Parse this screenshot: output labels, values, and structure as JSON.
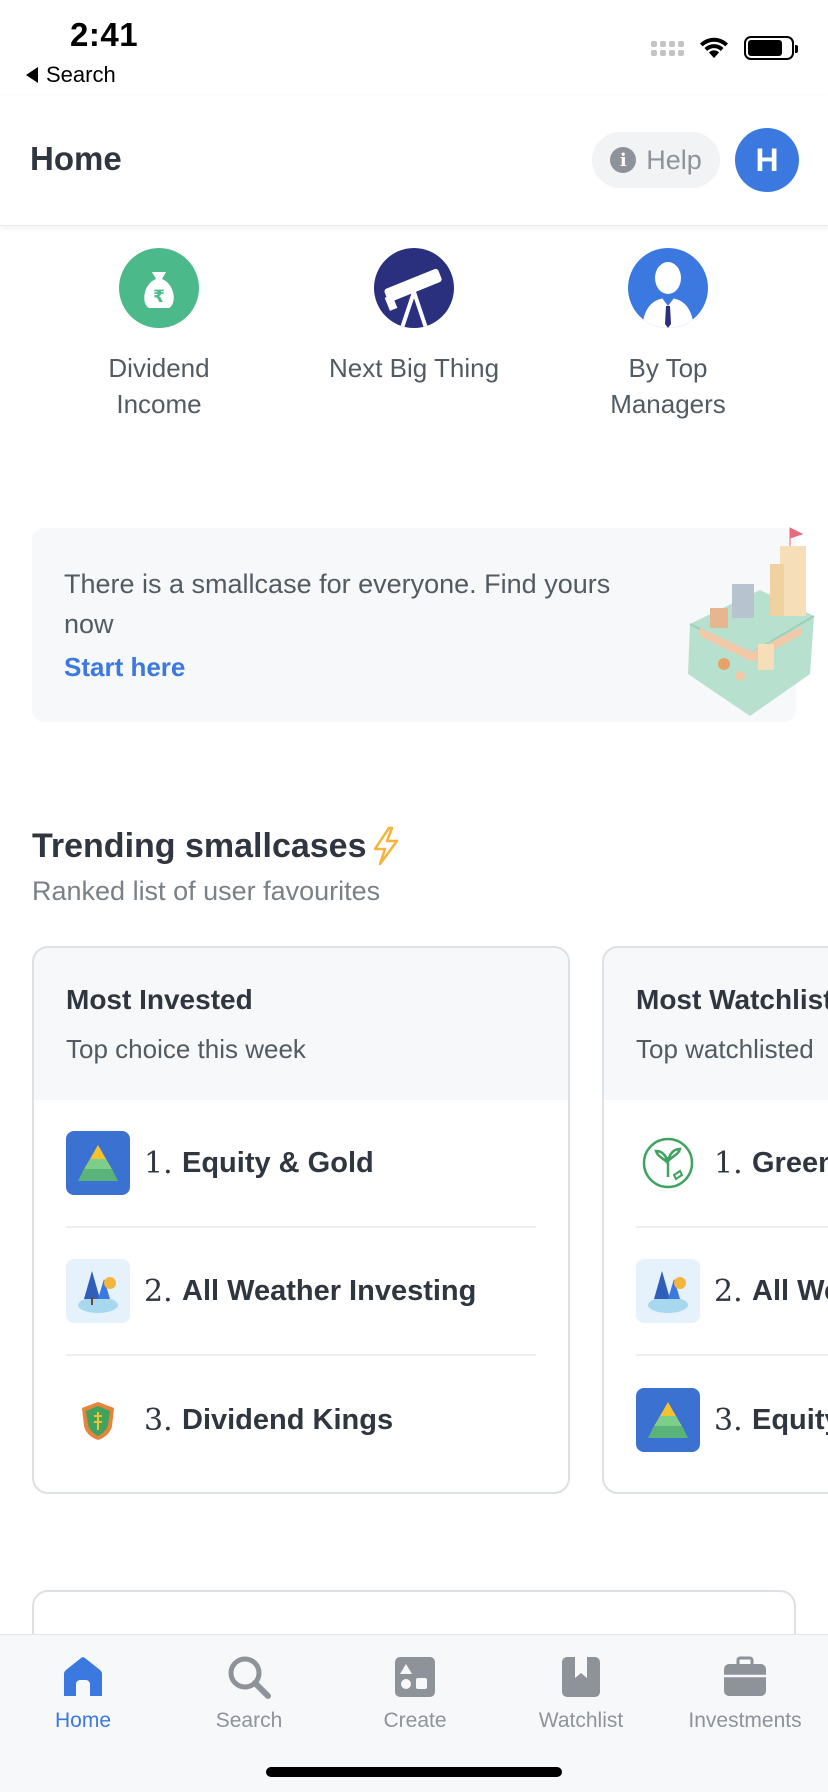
{
  "status_bar": {
    "time": "2:41",
    "back_label": "Search"
  },
  "header": {
    "title": "Home",
    "help_label": "Help",
    "avatar_initial": "H"
  },
  "categories": [
    {
      "label": "Dividend Income",
      "icon": "money-bag-icon",
      "color": "#4cb98a"
    },
    {
      "label": "Next Big Thing",
      "icon": "telescope-icon",
      "color": "#2a2f7e"
    },
    {
      "label": "By Top Managers",
      "icon": "manager-icon",
      "color": "#3b78e0"
    }
  ],
  "banner": {
    "text": "There is a smallcase for everyone. Find yours now",
    "link_label": "Start here",
    "art": "isometric-city-map-illustration"
  },
  "trending": {
    "title": "Trending smallcases",
    "title_icon": "lightning-icon",
    "subtitle": "Ranked list of user favourites",
    "cards": [
      {
        "title": "Most Invested",
        "subtitle": "Top choice this week",
        "items": [
          {
            "rank": "1.",
            "name": "Equity & Gold",
            "icon": "pyramid-icon"
          },
          {
            "rank": "2.",
            "name": "All Weather Investing",
            "icon": "trees-icon"
          },
          {
            "rank": "3.",
            "name": "Dividend Kings",
            "icon": "shield-crest-icon"
          }
        ]
      },
      {
        "title": "Most Watchlisted",
        "subtitle": "Top watchlisted",
        "items": [
          {
            "rank": "1.",
            "name": "Green Energy",
            "icon": "green-plant-icon"
          },
          {
            "rank": "2.",
            "name": "All Weather Investing",
            "icon": "trees-icon"
          },
          {
            "rank": "3.",
            "name": "Equity & Gold",
            "icon": "pyramid-icon"
          }
        ]
      }
    ]
  },
  "tabs": [
    {
      "label": "Home",
      "icon": "home-icon",
      "active": true
    },
    {
      "label": "Search",
      "icon": "search-icon",
      "active": false
    },
    {
      "label": "Create",
      "icon": "create-icon",
      "active": false
    },
    {
      "label": "Watchlist",
      "icon": "bookmark-icon",
      "active": false
    },
    {
      "label": "Investments",
      "icon": "briefcase-icon",
      "active": false
    }
  ],
  "colors": {
    "accent": "#3b78e0",
    "text": "#2f363f",
    "muted": "#8e9399",
    "surface": "#f7f8fa"
  }
}
